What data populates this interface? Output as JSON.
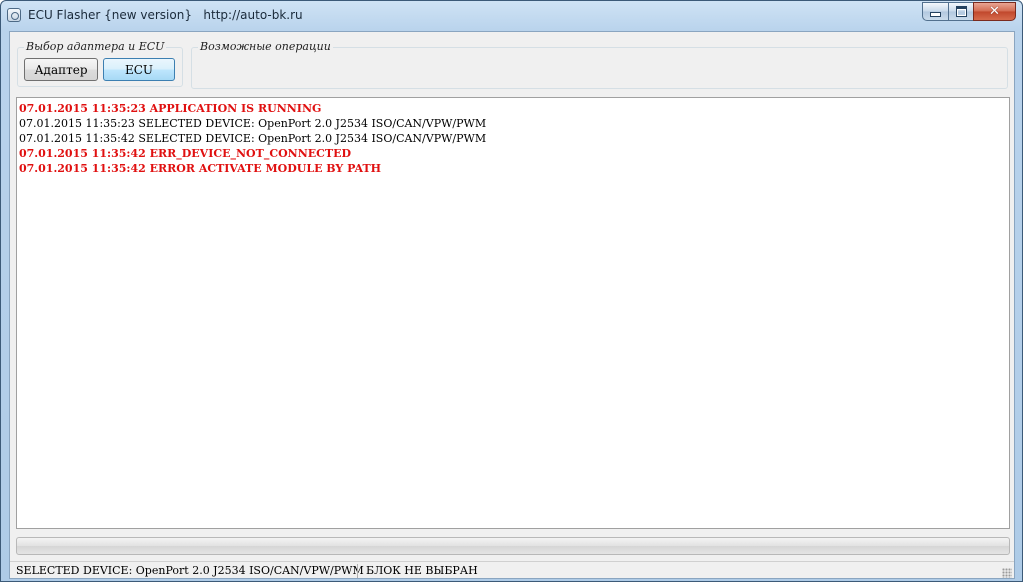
{
  "window": {
    "title": "ECU Flasher {new version}   http://auto-bk.ru"
  },
  "groups": {
    "adapter": {
      "legend": "Выбор адаптера и ECU",
      "adapter_button": "Адаптер",
      "ecu_button": "ECU"
    },
    "operations": {
      "legend": "Возможные операции"
    }
  },
  "log": {
    "lines": [
      {
        "text": "07.01.2015 11:35:23 APPLICATION IS RUNNING",
        "level": "error"
      },
      {
        "text": "07.01.2015 11:35:23 SELECTED DEVICE: OpenPort 2.0 J2534 ISO/CAN/VPW/PWM",
        "level": "info"
      },
      {
        "text": "07.01.2015 11:35:42 SELECTED DEVICE: OpenPort 2.0 J2534 ISO/CAN/VPW/PWM",
        "level": "info"
      },
      {
        "text": "07.01.2015 11:35:42 ERR_DEVICE_NOT_CONNECTED",
        "level": "error"
      },
      {
        "text": "07.01.2015 11:35:42 ERROR ACTIVATE MODULE BY PATH",
        "level": "error"
      }
    ]
  },
  "progress": {
    "value": 0
  },
  "status": {
    "device": "SELECTED DEVICE: OpenPort 2.0 J2534 ISO/CAN/VPW/PWM",
    "block": "БЛОК НЕ ВЫБРАН"
  },
  "colors": {
    "error_text": "#e01010",
    "info_text": "#000000"
  },
  "icons": {
    "app": "app-icon",
    "minimize": "minimize-icon",
    "maximize": "maximize-icon",
    "close": "close-icon"
  }
}
